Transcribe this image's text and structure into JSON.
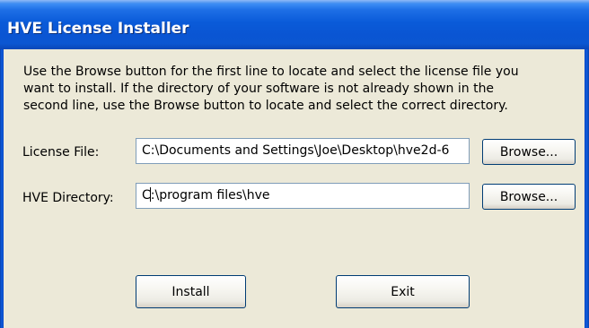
{
  "window": {
    "title": "HVE License Installer"
  },
  "description": {
    "line1": "Use the Browse button for the first line to locate and select the license file you",
    "line2": "want to install.  If the directory of your software is not already shown in the",
    "line3": "second line, use the Browse button to locate and select the correct directory."
  },
  "license_file": {
    "label": "License File:",
    "value": "C:\\Documents and Settings\\Joe\\Desktop\\hve2d-6",
    "browse_label": "Browse..."
  },
  "hve_directory": {
    "label": "HVE Directory:",
    "value_before_caret": "C",
    "value_after_caret": ":\\program files\\hve",
    "browse_label": "Browse..."
  },
  "buttons": {
    "install_label": "Install",
    "exit_label": "Exit"
  },
  "colors": {
    "titlebar": "#0a5bd9",
    "dialog_background": "#ece9d8",
    "button_border": "#003c74",
    "textbox_border": "#7f9db9"
  },
  "icons": [
    "text-caret"
  ]
}
